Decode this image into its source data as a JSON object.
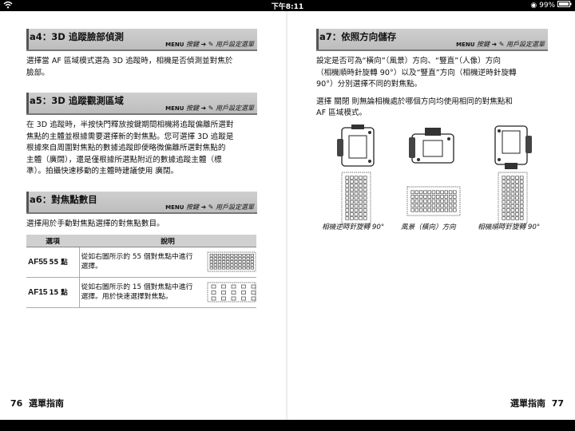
{
  "status": {
    "time": "下午8:11",
    "battery": "99%"
  },
  "left": {
    "sections": [
      {
        "title": "a4：3D 追蹤臉部偵測",
        "crumb_menu": "MENU",
        "crumb_text": "按鍵 ➜ ✎ 用戶設定選單",
        "body": [
          "選擇當 AF 區域模式選為 3D 追蹤時，相機是否偵測並對焦於",
          "臉部。"
        ]
      },
      {
        "title": "a5：3D 追蹤觀測區域",
        "crumb_menu": "MENU",
        "crumb_text": "按鍵 ➜ ✎ 用戶設定選單",
        "body": [
          "在 3D 追蹤時，半按快門釋放按鍵期間相機將追蹤偏離所選對",
          "焦點的主體並根據需要選擇新的對焦點。您可選擇 3D 追蹤是",
          "根據來自周圍對焦點的數據追蹤即便略微偏離所選對焦點的",
          "主體（廣闊），還是僅根據所選點附近的數據追蹤主體（標",
          "準）。拍攝快速移動的主體時建議使用 廣闊。"
        ]
      },
      {
        "title": "a6：對焦點數目",
        "crumb_menu": "MENU",
        "crumb_text": "按鍵 ➜ ✎ 用戶設定選單",
        "body": [
          "選擇用於手動對焦點選擇的對焦點數目。"
        ]
      }
    ],
    "table": {
      "headers": [
        "選項",
        "說明"
      ],
      "rows": [
        {
          "code": "AF55",
          "points": "55 點",
          "desc": [
            "從如右圖所示的 55 個對焦點中進行",
            "選擇。"
          ]
        },
        {
          "code": "AF15",
          "points": "15 點",
          "desc": [
            "從如右圖所示的 15 個對焦點中進行",
            "選擇。用於快速選擇對焦點。"
          ]
        }
      ]
    },
    "page_number": "76",
    "footer_title": "選單指南"
  },
  "right": {
    "section": {
      "title": "a7：依照方向儲存",
      "crumb_menu": "MENU",
      "crumb_text": "按鍵 ➜ ✎ 用戶設定選單",
      "body1": [
        "設定是否可為“橫向”（風景）方向、“豎直”（人像）方向",
        "（相機順時針旋轉 90°）以及“豎直”方向（相機逆時針旋轉",
        "90°）分別選擇不同的對焦點。"
      ],
      "body2": [
        "選擇 關閉 則無論相機處於哪個方向均使用相同的對焦點和",
        "AF 區域模式。"
      ]
    },
    "captions": [
      "相機逆時針旋轉 90°",
      "風景（橫向）方向",
      "相機順時針旋轉 90°"
    ],
    "page_number": "77",
    "footer_title": "選單指南"
  }
}
